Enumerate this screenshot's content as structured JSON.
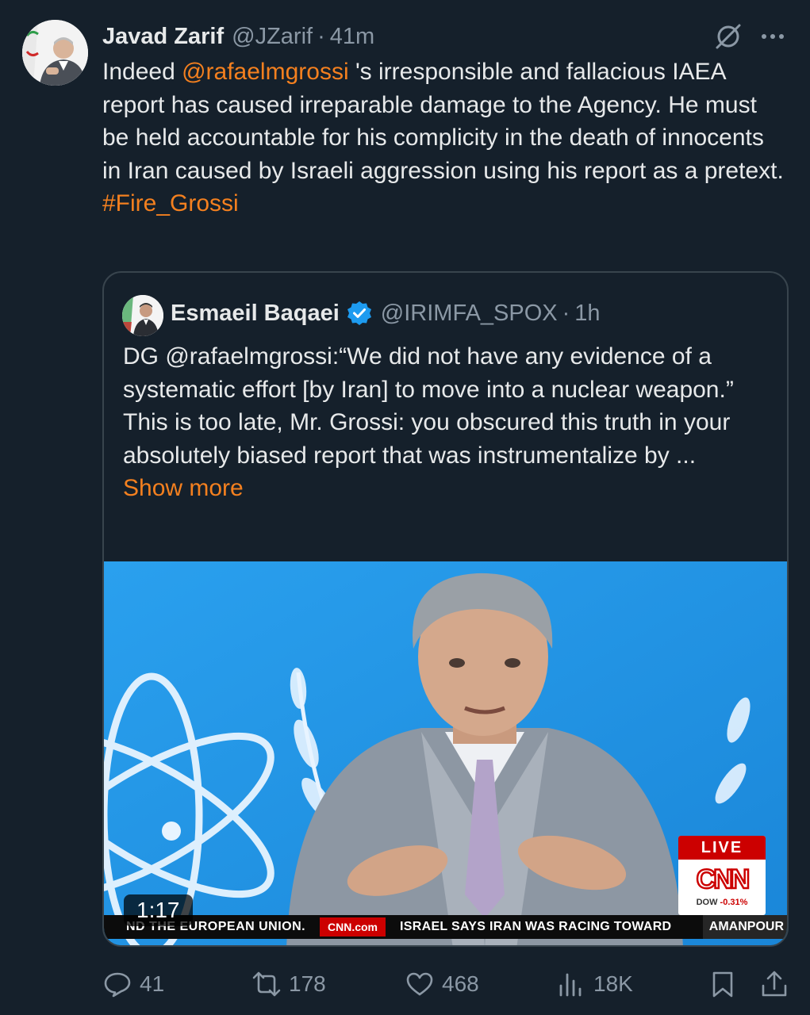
{
  "tweet": {
    "author_name": "Javad Zarif",
    "author_handle": "@JZarif",
    "separator": "·",
    "time": "41m",
    "text_parts": {
      "t1": "Indeed ",
      "mention": "@rafaelmgrossi",
      "t2": " 's irresponsible and fallacious IAEA report has caused irreparable damage to the Agency. He must be held accountable for his complicity in the death of innocents in Iran caused by Israeli aggression using his report as a pretext.",
      "hashtag": "#Fire_Grossi"
    }
  },
  "quote": {
    "author_name": "Esmaeil Baqaei",
    "author_handle": "@IRIMFA_SPOX",
    "separator": "·",
    "time": "1h",
    "line1": "DG @rafaelmgrossi:“We did not have any evidence of a systematic effort [by Iran] to move into a nuclear weapon.”",
    "line2": "This is too late, Mr. Grossi: you obscured this truth in your absolutely biased report that was instrumentalize by ...",
    "show_more": "Show more",
    "video": {
      "duration": "1:17",
      "ticker_left": "ND THE EUROPEAN UNION.",
      "ticker_source": "CNN.com",
      "ticker_main": "ISRAEL SAYS IRAN WAS RACING TOWARD",
      "ticker_show": "AMANPOUR",
      "live_label": "LIVE",
      "network": "CNN",
      "dow_label": "DOW",
      "dow_value": "-0.31%"
    }
  },
  "actions": {
    "replies": "41",
    "reposts": "178",
    "likes": "468",
    "views": "18K"
  },
  "colors": {
    "background": "#15202b",
    "accent": "#f4801f",
    "secondary_text": "#8b98a5",
    "verified": "#1d9bf0"
  }
}
